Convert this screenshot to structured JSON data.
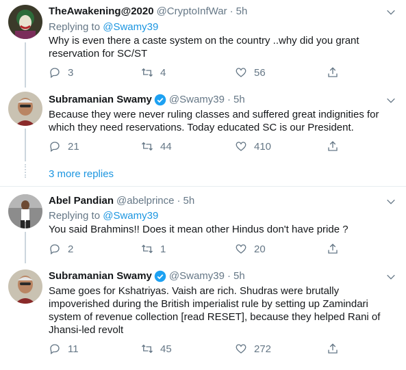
{
  "tweets": [
    {
      "name": "TheAwakening@2020",
      "handle": "@CryptoInfWar",
      "time": "5h",
      "replying_label": "Replying to",
      "replying_to": "@Swamy39",
      "text": "Why is even there a caste system on the country ..why did you grant reservation for SC/ST",
      "replies": "3",
      "retweets": "4",
      "likes": "56"
    },
    {
      "name": "Subramanian Swamy",
      "handle": "@Swamy39",
      "time": "5h",
      "text": "Because they were never ruling classes  and suffered great indignities for which they need reservations. Today educated SC is our President.",
      "replies": "21",
      "retweets": "44",
      "likes": "410"
    },
    {
      "name": "Abel Pandian",
      "handle": "@abelprince",
      "time": "5h",
      "replying_label": "Replying to",
      "replying_to": "@Swamy39",
      "text": "You said Brahmins!! Does it mean other Hindus don't have pride ?",
      "replies": "2",
      "retweets": "1",
      "likes": "20"
    },
    {
      "name": "Subramanian Swamy",
      "handle": "@Swamy39",
      "time": "5h",
      "text": "Same goes for Kshatriyas. Vaish are rich.  Shudras were  brutally impoverished during the British imperialist rule by setting up Zamindari system of revenue collection [read RESET], because they helped Rani of Jhansi-led revolt",
      "replies": "11",
      "retweets": "45",
      "likes": "272"
    }
  ],
  "more_replies": "3 more replies",
  "colors": {
    "text": "#14171a",
    "muted": "#657786",
    "link": "#1b95e0",
    "verified": "#1da1f2",
    "divider": "#e6ecf0"
  },
  "icons": [
    "reply-icon",
    "retweet-icon",
    "like-icon",
    "share-icon",
    "verified-badge-icon",
    "chevron-down-icon"
  ]
}
